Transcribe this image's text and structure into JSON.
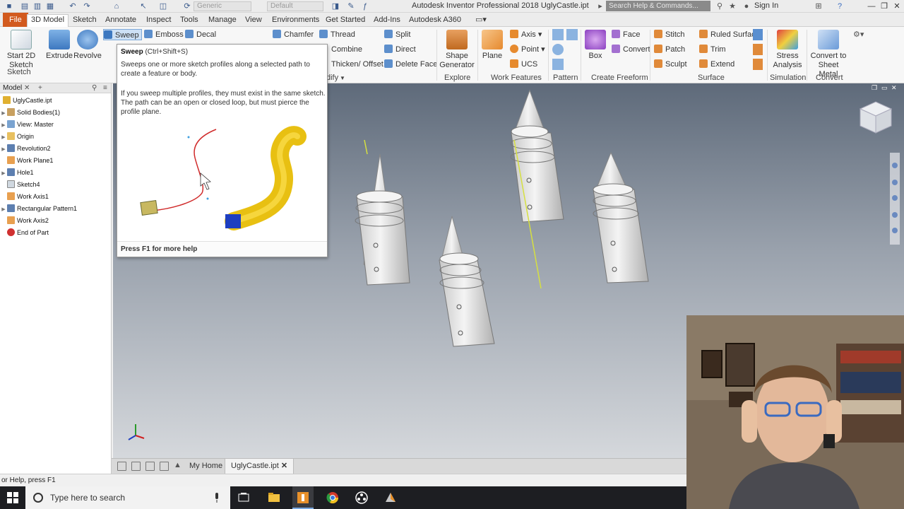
{
  "titlebar": {
    "app_title": "Autodesk Inventor Professional 2018    UglyCastle.ipt",
    "material": "Generic",
    "appearance": "Default",
    "search_placeholder": "Search Help & Commands...",
    "sign_in": "Sign In"
  },
  "tabs": [
    "File",
    "3D Model",
    "Sketch",
    "Annotate",
    "Inspect",
    "Tools",
    "Manage",
    "View",
    "Environments",
    "Get Started",
    "Add-Ins",
    "Autodesk A360"
  ],
  "ribbon": {
    "start_sketch": "Start 2D Sketch",
    "extrude": "Extrude",
    "revolve": "Revolve",
    "sweep": "Sweep",
    "emboss": "Emboss",
    "decal": "Decal",
    "chamfer": "Chamfer",
    "thread": "Thread",
    "split": "Split",
    "combine": "Combine",
    "direct": "Direct",
    "thicken": "Thicken/ Offset",
    "delete_face": "Delete Face",
    "shape_generator": "Shape Generator",
    "plane": "Plane",
    "axis": "Axis",
    "point": "Point",
    "ucs": "UCS",
    "box": "Box",
    "face": "Face",
    "convert": "Convert",
    "stitch": "Stitch",
    "patch": "Patch",
    "sculpt": "Sculpt",
    "ruled_surface": "Ruled Surface",
    "trim": "Trim",
    "extend": "Extend",
    "stress_analysis": "Stress Analysis",
    "convert_sheet_metal": "Convert to Sheet Metal",
    "panels": {
      "sketch": "Sketch",
      "modify": "dify",
      "explore": "Explore",
      "work_features": "Work Features",
      "pattern": "Pattern",
      "create_freeform": "Create Freeform",
      "surface": "Surface",
      "simulation": "Simulation",
      "convert": "Convert"
    }
  },
  "browser": {
    "tab": "Model",
    "items": [
      {
        "label": "UglyCastle.ipt",
        "indent": 0
      },
      {
        "label": "Solid Bodies(1)",
        "indent": 1
      },
      {
        "label": "View: Master",
        "indent": 1
      },
      {
        "label": "Origin",
        "indent": 1
      },
      {
        "label": "Revolution2",
        "indent": 1
      },
      {
        "label": "Work Plane1",
        "indent": 1
      },
      {
        "label": "Hole1",
        "indent": 1
      },
      {
        "label": "Sketch4",
        "indent": 1
      },
      {
        "label": "Work Axis1",
        "indent": 1
      },
      {
        "label": "Rectangular Pattern1",
        "indent": 1
      },
      {
        "label": "Work Axis2",
        "indent": 1
      },
      {
        "label": "End of Part",
        "indent": 1
      }
    ]
  },
  "tooltip": {
    "title": "Sweep",
    "shortcut": "(Ctrl+Shift+S)",
    "desc1": "Sweeps one or more sketch profiles along a selected path to create a feature or body.",
    "desc2": "If you sweep multiple profiles, they must exist in the same sketch. The path can be an open or closed loop, but must pierce the profile plane.",
    "help": "Press F1 for more help"
  },
  "doctabs": {
    "home": "My Home",
    "doc": "UglyCastle.ipt"
  },
  "status": "or Help, press F1",
  "taskbar": {
    "search": "Type here to search"
  }
}
